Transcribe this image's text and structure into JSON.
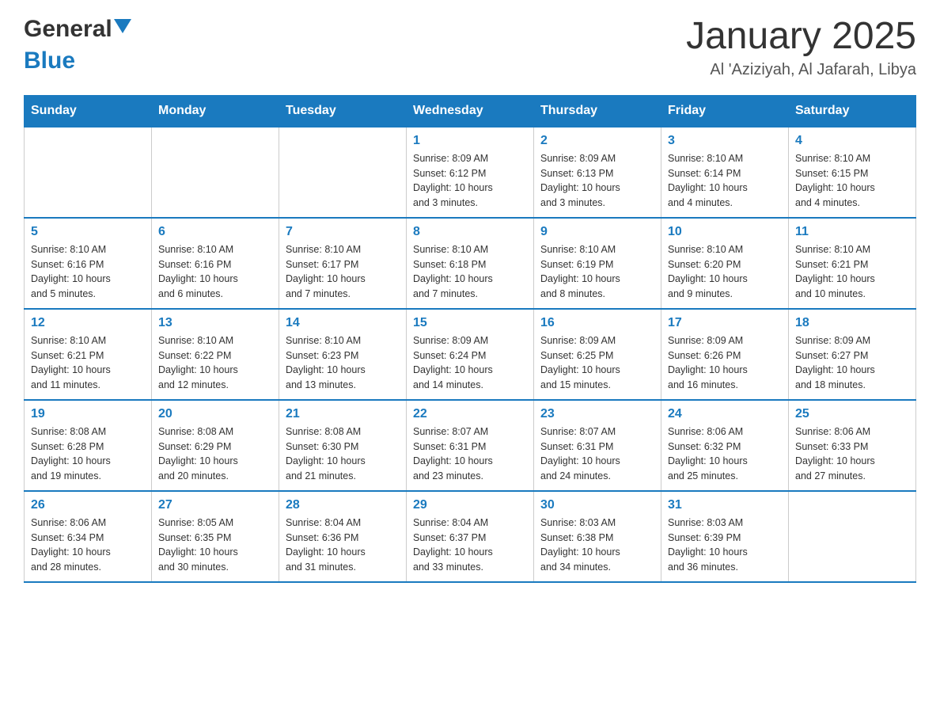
{
  "header": {
    "logo_general": "General",
    "logo_blue": "Blue",
    "month_title": "January 2025",
    "location": "Al 'Aziziyah, Al Jafarah, Libya"
  },
  "days_of_week": [
    "Sunday",
    "Monday",
    "Tuesday",
    "Wednesday",
    "Thursday",
    "Friday",
    "Saturday"
  ],
  "weeks": [
    {
      "days": [
        {
          "number": "",
          "info": ""
        },
        {
          "number": "",
          "info": ""
        },
        {
          "number": "",
          "info": ""
        },
        {
          "number": "1",
          "info": "Sunrise: 8:09 AM\nSunset: 6:12 PM\nDaylight: 10 hours\nand 3 minutes."
        },
        {
          "number": "2",
          "info": "Sunrise: 8:09 AM\nSunset: 6:13 PM\nDaylight: 10 hours\nand 3 minutes."
        },
        {
          "number": "3",
          "info": "Sunrise: 8:10 AM\nSunset: 6:14 PM\nDaylight: 10 hours\nand 4 minutes."
        },
        {
          "number": "4",
          "info": "Sunrise: 8:10 AM\nSunset: 6:15 PM\nDaylight: 10 hours\nand 4 minutes."
        }
      ]
    },
    {
      "days": [
        {
          "number": "5",
          "info": "Sunrise: 8:10 AM\nSunset: 6:16 PM\nDaylight: 10 hours\nand 5 minutes."
        },
        {
          "number": "6",
          "info": "Sunrise: 8:10 AM\nSunset: 6:16 PM\nDaylight: 10 hours\nand 6 minutes."
        },
        {
          "number": "7",
          "info": "Sunrise: 8:10 AM\nSunset: 6:17 PM\nDaylight: 10 hours\nand 7 minutes."
        },
        {
          "number": "8",
          "info": "Sunrise: 8:10 AM\nSunset: 6:18 PM\nDaylight: 10 hours\nand 7 minutes."
        },
        {
          "number": "9",
          "info": "Sunrise: 8:10 AM\nSunset: 6:19 PM\nDaylight: 10 hours\nand 8 minutes."
        },
        {
          "number": "10",
          "info": "Sunrise: 8:10 AM\nSunset: 6:20 PM\nDaylight: 10 hours\nand 9 minutes."
        },
        {
          "number": "11",
          "info": "Sunrise: 8:10 AM\nSunset: 6:21 PM\nDaylight: 10 hours\nand 10 minutes."
        }
      ]
    },
    {
      "days": [
        {
          "number": "12",
          "info": "Sunrise: 8:10 AM\nSunset: 6:21 PM\nDaylight: 10 hours\nand 11 minutes."
        },
        {
          "number": "13",
          "info": "Sunrise: 8:10 AM\nSunset: 6:22 PM\nDaylight: 10 hours\nand 12 minutes."
        },
        {
          "number": "14",
          "info": "Sunrise: 8:10 AM\nSunset: 6:23 PM\nDaylight: 10 hours\nand 13 minutes."
        },
        {
          "number": "15",
          "info": "Sunrise: 8:09 AM\nSunset: 6:24 PM\nDaylight: 10 hours\nand 14 minutes."
        },
        {
          "number": "16",
          "info": "Sunrise: 8:09 AM\nSunset: 6:25 PM\nDaylight: 10 hours\nand 15 minutes."
        },
        {
          "number": "17",
          "info": "Sunrise: 8:09 AM\nSunset: 6:26 PM\nDaylight: 10 hours\nand 16 minutes."
        },
        {
          "number": "18",
          "info": "Sunrise: 8:09 AM\nSunset: 6:27 PM\nDaylight: 10 hours\nand 18 minutes."
        }
      ]
    },
    {
      "days": [
        {
          "number": "19",
          "info": "Sunrise: 8:08 AM\nSunset: 6:28 PM\nDaylight: 10 hours\nand 19 minutes."
        },
        {
          "number": "20",
          "info": "Sunrise: 8:08 AM\nSunset: 6:29 PM\nDaylight: 10 hours\nand 20 minutes."
        },
        {
          "number": "21",
          "info": "Sunrise: 8:08 AM\nSunset: 6:30 PM\nDaylight: 10 hours\nand 21 minutes."
        },
        {
          "number": "22",
          "info": "Sunrise: 8:07 AM\nSunset: 6:31 PM\nDaylight: 10 hours\nand 23 minutes."
        },
        {
          "number": "23",
          "info": "Sunrise: 8:07 AM\nSunset: 6:31 PM\nDaylight: 10 hours\nand 24 minutes."
        },
        {
          "number": "24",
          "info": "Sunrise: 8:06 AM\nSunset: 6:32 PM\nDaylight: 10 hours\nand 25 minutes."
        },
        {
          "number": "25",
          "info": "Sunrise: 8:06 AM\nSunset: 6:33 PM\nDaylight: 10 hours\nand 27 minutes."
        }
      ]
    },
    {
      "days": [
        {
          "number": "26",
          "info": "Sunrise: 8:06 AM\nSunset: 6:34 PM\nDaylight: 10 hours\nand 28 minutes."
        },
        {
          "number": "27",
          "info": "Sunrise: 8:05 AM\nSunset: 6:35 PM\nDaylight: 10 hours\nand 30 minutes."
        },
        {
          "number": "28",
          "info": "Sunrise: 8:04 AM\nSunset: 6:36 PM\nDaylight: 10 hours\nand 31 minutes."
        },
        {
          "number": "29",
          "info": "Sunrise: 8:04 AM\nSunset: 6:37 PM\nDaylight: 10 hours\nand 33 minutes."
        },
        {
          "number": "30",
          "info": "Sunrise: 8:03 AM\nSunset: 6:38 PM\nDaylight: 10 hours\nand 34 minutes."
        },
        {
          "number": "31",
          "info": "Sunrise: 8:03 AM\nSunset: 6:39 PM\nDaylight: 10 hours\nand 36 minutes."
        },
        {
          "number": "",
          "info": ""
        }
      ]
    }
  ]
}
